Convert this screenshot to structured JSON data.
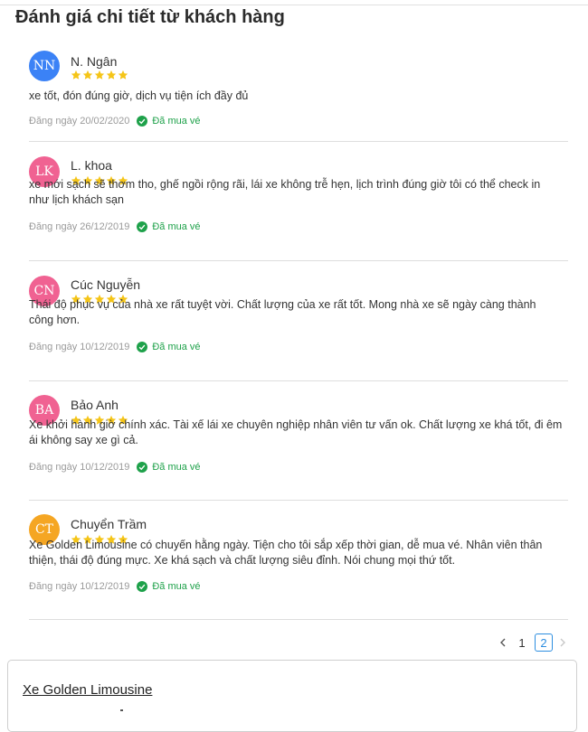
{
  "page": {
    "title": "Đánh giá chi tiết từ khách hàng"
  },
  "rating_max": 5,
  "verified_label": "Đã mua vé",
  "reviews": [
    {
      "initials": "NN",
      "name": "N. Ngân",
      "avatar_color": "#3b82f6",
      "rating": 5,
      "comment": "xe tốt, đón đúng giờ, dịch vụ tiện ích đầy đủ",
      "date": "Đăng ngày 20/02/2020"
    },
    {
      "initials": "LK",
      "name": "L. khoa",
      "avatar_color": "#f06292",
      "rating": 5,
      "comment": "xe mới sạch sẽ thơm tho, ghế ngồi rộng rãi, lái xe không trễ hẹn, lịch trình đúng giờ tôi có thể check in như lịch khách sạn",
      "date": "Đăng ngày 26/12/2019"
    },
    {
      "initials": "CN",
      "name": "Cúc Nguyễn",
      "avatar_color": "#f06292",
      "rating": 5,
      "comment": "Thái độ phục vụ của nhà xe rất tuyệt vời. Chất lượng của xe rất tốt. Mong nhà xe sẽ ngày càng thành công hơn.",
      "date": "Đăng ngày 10/12/2019"
    },
    {
      "initials": "BA",
      "name": "Bảo Anh",
      "avatar_color": "#f06292",
      "rating": 5,
      "comment": "Xe khởi hành giờ chính xác. Tài xế lái xe chuyên nghiệp nhân viên tư vấn ok. Chất lượng xe khá tốt, đi êm ái không say xe gì cả.",
      "date": "Đăng ngày 10/12/2019"
    },
    {
      "initials": "CT",
      "name": "Chuyển Trầm",
      "avatar_color": "#f5a623",
      "rating": 5,
      "comment": "Xe Golden Limousine có chuyến hằng ngày. Tiện cho tôi sắp xếp thời gian, dễ mua vé. Nhân viên thân thiện, thái độ đúng mực. Xe khá sạch và chất lượng siêu đỉnh. Nói chung mọi thứ tốt.",
      "date": "Đăng ngày 10/12/2019"
    }
  ],
  "pagination": {
    "pages": [
      "1",
      "2"
    ],
    "current": "2"
  },
  "card": {
    "title": "Xe Golden Limousine"
  },
  "colors": {
    "star": "#f5c518",
    "verified": "#1ea14a",
    "pagination_active": "#2d8ee0"
  }
}
